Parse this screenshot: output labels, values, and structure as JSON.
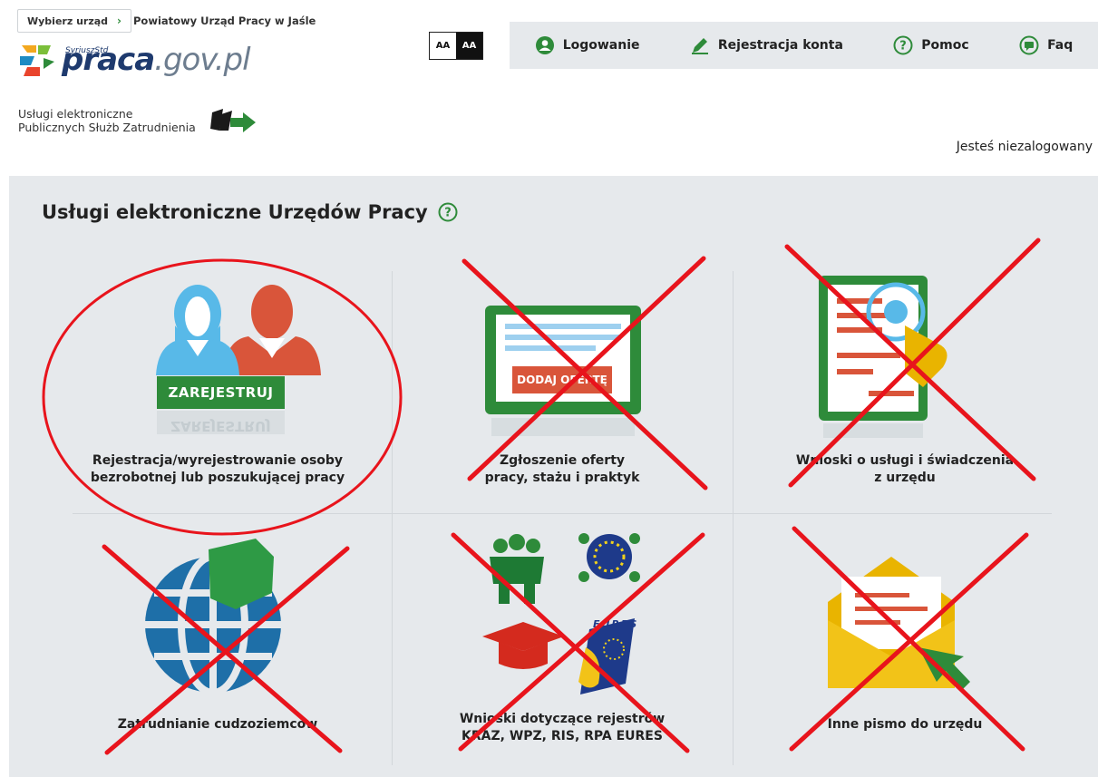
{
  "header": {
    "select_office_label": "Wybierz urząd",
    "office_name": "Powiatowy Urząd Pracy w Jaśle",
    "logo": {
      "superscript": "SyriuszStd",
      "main": "praca",
      "suffix": ".gov.pl"
    },
    "tagline_line1": "Usługi elektroniczne",
    "tagline_line2": "Publicznych Służb Zatrudnienia",
    "contrast": {
      "normal": "AA",
      "high": "AA"
    },
    "nav": {
      "login": "Logowanie",
      "register": "Rejestracja konta",
      "help": "Pomoc",
      "faq": "Faq"
    },
    "status": "Jesteś niezalogowany"
  },
  "panel": {
    "title": "Usługi elektroniczne Urzędów Pracy",
    "tiles": [
      {
        "line1": "Rejestracja/wyrejestrowanie osoby",
        "line2": "bezrobotnej lub poszukującej pracy",
        "badge": "ZAREJESTRUJ",
        "mirror": "ZAREJESTRUJ",
        "state": "circled"
      },
      {
        "line1": "Zgłoszenie oferty",
        "line2": "pracy, stażu i praktyk",
        "badge": "DODAJ OFERTĘ",
        "state": "crossed"
      },
      {
        "line1": "Wnioski o usługi i świadczenia",
        "line2": "z urzędu",
        "state": "crossed"
      },
      {
        "line1": "Zatrudnianie cudzoziemców",
        "state": "crossed"
      },
      {
        "line1": "Wnioski dotyczące rejestrów",
        "line2": "KRAZ, WPZ, RIS, RPA EURES",
        "badge": "EURES",
        "state": "crossed"
      },
      {
        "line1": "Inne pismo do urzędu",
        "state": "crossed"
      }
    ]
  },
  "colors": {
    "green": "#2e8b3a",
    "navy": "#1e3a6e",
    "panel": "#e6e9ec",
    "annotation_red": "#e8141c"
  }
}
